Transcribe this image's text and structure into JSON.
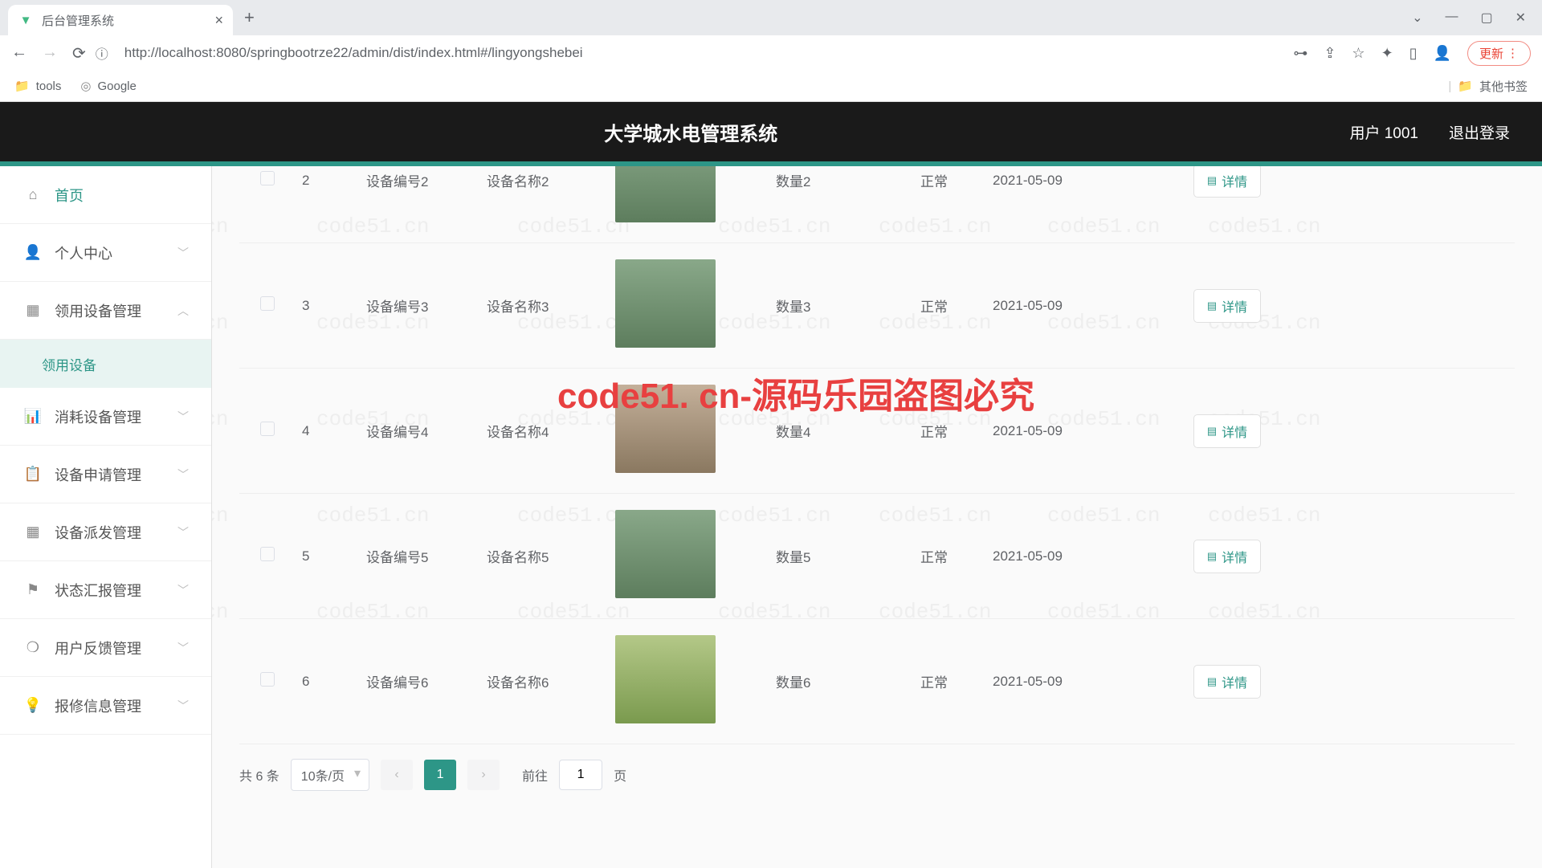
{
  "browser": {
    "tab_title": "后台管理系统",
    "url": "http://localhost:8080/springbootrze22/admin/dist/index.html#/lingyongshebei",
    "update_btn": "更新",
    "bookmarks": {
      "tools": "tools",
      "google": "Google",
      "other": "其他书签"
    }
  },
  "header": {
    "title": "大学城水电管理系统",
    "user": "用户 1001",
    "logout": "退出登录"
  },
  "sidebar": {
    "items": [
      {
        "icon": "home",
        "label": "首页",
        "active": true
      },
      {
        "icon": "user",
        "label": "个人中心",
        "chevron": "down"
      },
      {
        "icon": "box",
        "label": "领用设备管理",
        "chevron": "up",
        "expanded": true
      },
      {
        "icon": "bars",
        "label": "消耗设备管理",
        "chevron": "down"
      },
      {
        "icon": "doc",
        "label": "设备申请管理",
        "chevron": "down"
      },
      {
        "icon": "grid",
        "label": "设备派发管理",
        "chevron": "down"
      },
      {
        "icon": "flag",
        "label": "状态汇报管理",
        "chevron": "down"
      },
      {
        "icon": "help",
        "label": "用户反馈管理",
        "chevron": "down"
      },
      {
        "icon": "bulb",
        "label": "报修信息管理",
        "chevron": "down"
      }
    ],
    "submenu_item": "领用设备"
  },
  "table": {
    "detail_btn": "详情",
    "rows": [
      {
        "idx": "2",
        "code": "设备编号2",
        "name": "设备名称2",
        "qty": "数量2",
        "status": "正常",
        "date": "2021-05-09",
        "img": "park",
        "partial": true
      },
      {
        "idx": "3",
        "code": "设备编号3",
        "name": "设备名称3",
        "qty": "数量3",
        "status": "正常",
        "date": "2021-05-09",
        "img": "park"
      },
      {
        "idx": "4",
        "code": "设备编号4",
        "name": "设备名称4",
        "qty": "数量4",
        "status": "正常",
        "date": "2021-05-09",
        "img": "bldg"
      },
      {
        "idx": "5",
        "code": "设备编号5",
        "name": "设备名称5",
        "qty": "数量5",
        "status": "正常",
        "date": "2021-05-09",
        "img": "park"
      },
      {
        "idx": "6",
        "code": "设备编号6",
        "name": "设备名称6",
        "qty": "数量6",
        "status": "正常",
        "date": "2021-05-09",
        "img": "green"
      }
    ]
  },
  "pagination": {
    "total_label": "共 6 条",
    "page_size": "10条/页",
    "current": "1",
    "goto_prefix": "前往",
    "goto_value": "1",
    "goto_suffix": "页"
  },
  "watermark": "code51. cn-源码乐园盗图必究",
  "bg_watermark": "code51.cn"
}
